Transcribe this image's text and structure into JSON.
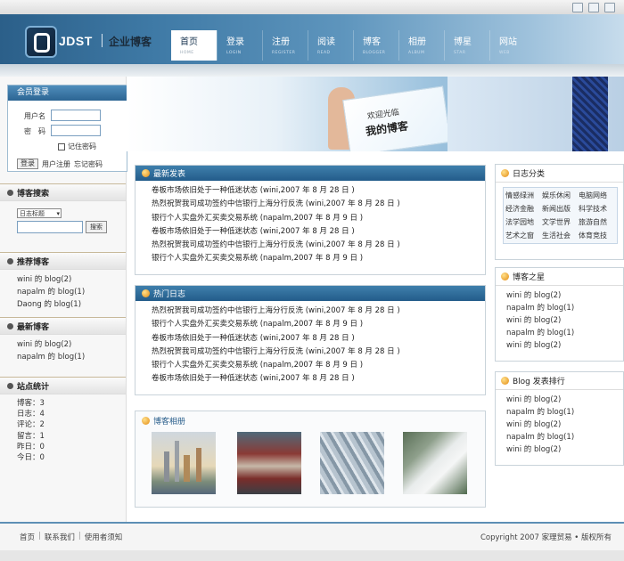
{
  "brand": {
    "logo_text": "JDST",
    "site_title": "企业博客"
  },
  "nav": [
    {
      "zh": "首页",
      "en": "HOME"
    },
    {
      "zh": "登录",
      "en": "LOGIN"
    },
    {
      "zh": "注册",
      "en": "REGISTER"
    },
    {
      "zh": "阅读",
      "en": "READ"
    },
    {
      "zh": "博客",
      "en": "BLOGGER"
    },
    {
      "zh": "相册",
      "en": "ALBUM"
    },
    {
      "zh": "博星",
      "en": "STAR"
    },
    {
      "zh": "网站",
      "en": "WEB"
    }
  ],
  "banner": {
    "welcome": "欢迎光临",
    "title": "我的博客"
  },
  "login": {
    "title": "会员登录",
    "username_label": "用户名",
    "password_label": "密　码",
    "remember_label": "记住密码",
    "login_button": "登录",
    "register_link": "用户注册",
    "forgot_link": "忘记密码"
  },
  "blog_search": {
    "title": "博客搜索",
    "select_value": "日志标题",
    "search_button": "搜索"
  },
  "recommended": {
    "title": "推荐博客",
    "items": [
      "wini 的 blog(2)",
      "napalm 的 blog(1)",
      "Daong 的 blog(1)"
    ]
  },
  "latest_blogs": {
    "title": "最新博客",
    "items": [
      "wini 的 blog(2)",
      "napalm 的 blog(1)"
    ]
  },
  "stats": {
    "title": "站点统计",
    "items": [
      "博客：3",
      "日志：4",
      "评论：2",
      "留言：1",
      "昨日：0",
      "今日：0"
    ]
  },
  "latest_posts": {
    "title": "最新发表",
    "items": [
      "卷板市场依旧处于一种低迷状态 (wini,2007 年 8 月 28 日 )",
      "热烈祝贺我司成功签约中信银行上海分行反洗 (wini,2007 年 8 月 28 日 )",
      "银行个人实盘外汇买卖交易系统 (napalm,2007 年 8 月 9 日 )",
      "卷板市场依旧处于一种低迷状态 (wini,2007 年 8 月 28 日 )",
      "热烈祝贺我司成功签约中信银行上海分行反洗 (wini,2007 年 8 月 28 日 )",
      "银行个人实盘外汇买卖交易系统 (napalm,2007 年 8 月 9 日 )"
    ]
  },
  "hot_posts": {
    "title": "热门日志",
    "items": [
      "热烈祝贺我司成功签约中信银行上海分行反洗 (wini,2007 年 8 月 28 日 )",
      "银行个人实盘外汇买卖交易系统 (napalm,2007 年 8 月 9 日 )",
      "卷板市场依旧处于一种低迷状态 (wini,2007 年 8 月 28 日 )",
      "热烈祝贺我司成功签约中信银行上海分行反洗 (wini,2007 年 8 月 28 日 )",
      "银行个人实盘外汇买卖交易系统 (napalm,2007 年 8 月 9 日 )",
      "卷板市场依旧处于一种低迷状态 (wini,2007 年 8 月 28 日 )"
    ]
  },
  "album": {
    "title": "博客相册"
  },
  "categories": {
    "title": "日志分类",
    "items": [
      "情感绿洲",
      "娱乐休闲",
      "电脑网络",
      "经济金融",
      "新闻出版",
      "科学技术",
      "法学园地",
      "文学世界",
      "旅游自然",
      "艺术之窗",
      "生活社会",
      "体育竞技"
    ]
  },
  "blog_stars": {
    "title": "博客之星",
    "items": [
      "wini 的 blog(2)",
      "napalm 的 blog(1)",
      "wini 的 blog(2)",
      "napalm 的 blog(1)",
      "wini 的 blog(2)"
    ]
  },
  "blog_ranking": {
    "title": "Blog 发表排行",
    "items": [
      "wini 的 blog(2)",
      "napalm 的 blog(1)",
      "wini 的 blog(2)",
      "napalm 的 blog(1)",
      "wini 的 blog(2)"
    ]
  },
  "footer": {
    "links": [
      "首页",
      "联系我们",
      "使用者须知"
    ],
    "copyright": "Copyright 2007 家理贸易 • 版权所有"
  }
}
